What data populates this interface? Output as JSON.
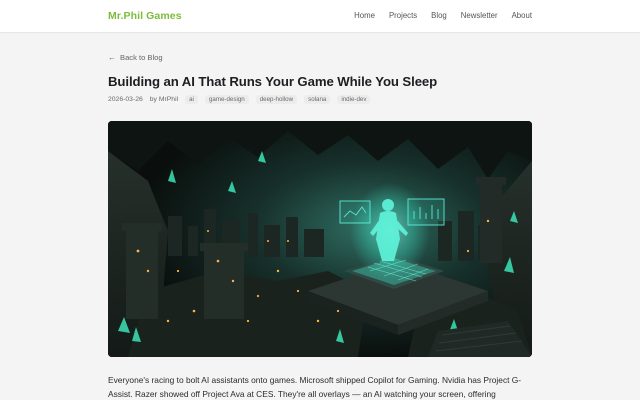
{
  "header": {
    "brand": "Mr.Phil Games",
    "nav": [
      "Home",
      "Projects",
      "Blog",
      "Newsletter",
      "About"
    ]
  },
  "back_link": "Back to Blog",
  "post": {
    "title": "Building an AI That Runs Your Game While You Sleep",
    "date": "2026-03-26",
    "author": "by MrPhil",
    "tags": [
      "ai",
      "game-design",
      "deep-hollow",
      "solana",
      "indie-dev"
    ],
    "hero_image": "cavern-city-hologram-illustration",
    "body": "Everyone's racing to bolt AI assistants onto games. Microsoft shipped Copilot for Gaming. Nvidia has Project G-Assist. Razer showed off Project Ava at CES. They're all overlays — an AI watching your screen, offering"
  },
  "colors": {
    "brand": "#7cbc3a",
    "page_bg": "#f4f4f4",
    "hologram": "#3ef0d0"
  }
}
